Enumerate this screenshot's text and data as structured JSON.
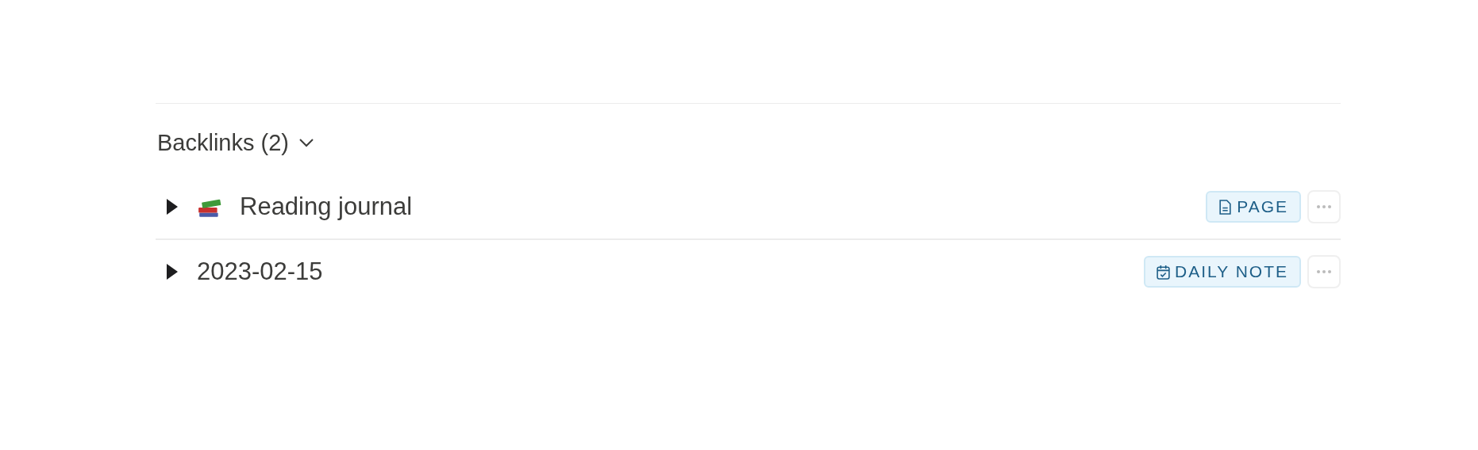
{
  "backlinks": {
    "title": "Backlinks (2)",
    "expanded": true,
    "items": [
      {
        "title": "Reading journal",
        "kind": "page",
        "has_emoji": true,
        "expanded": false,
        "tag": "PAGE"
      },
      {
        "title": "2023-02-15",
        "kind": "daily_note",
        "has_emoji": false,
        "expanded": false,
        "tag": "DAILY NOTE"
      }
    ]
  }
}
